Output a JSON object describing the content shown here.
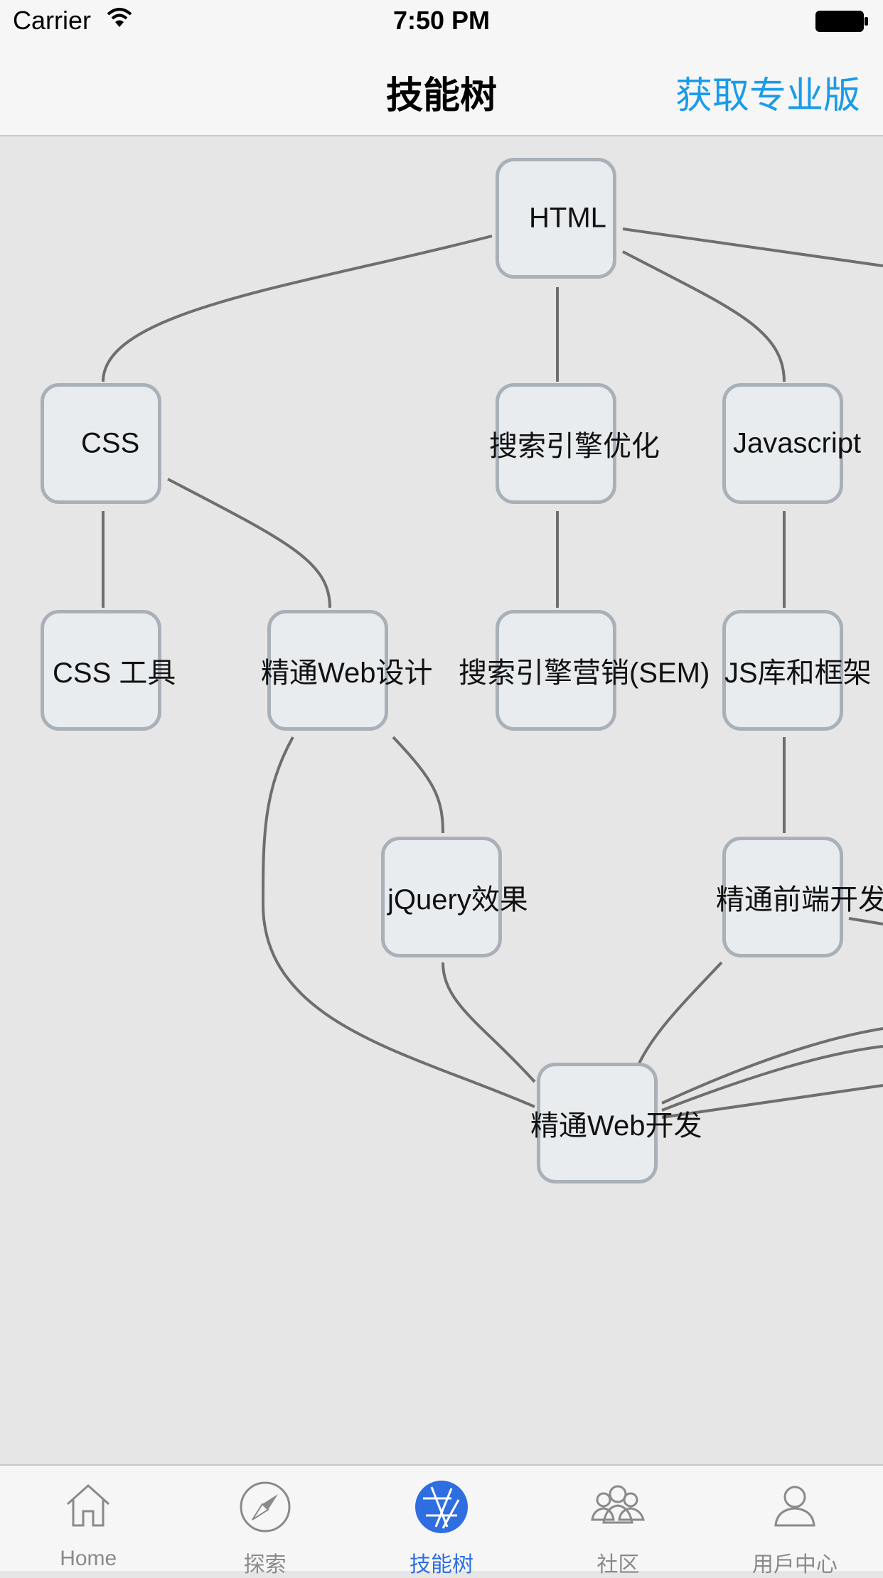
{
  "status_bar": {
    "carrier": "Carrier",
    "time": "7:50 PM"
  },
  "nav": {
    "title": "技能树",
    "pro_button": "获取专业版"
  },
  "skill_tree": {
    "nodes": [
      {
        "id": "html",
        "label": "HTML"
      },
      {
        "id": "css",
        "label": "CSS"
      },
      {
        "id": "seo",
        "label": "搜索引擎优化"
      },
      {
        "id": "javascript",
        "label": "Javascript"
      },
      {
        "id": "css-tools",
        "label": "CSS 工具"
      },
      {
        "id": "web-design",
        "label": "精通Web设计"
      },
      {
        "id": "sem",
        "label": "搜索引擎营销(SEM)"
      },
      {
        "id": "js-libs",
        "label": "JS库和框架"
      },
      {
        "id": "jquery",
        "label": "jQuery效果"
      },
      {
        "id": "frontend",
        "label": "精通前端开发"
      },
      {
        "id": "web-dev",
        "label": "精通Web开发"
      }
    ]
  },
  "tab_bar": {
    "active": "skill-tree",
    "items": [
      {
        "id": "home",
        "label": "Home",
        "icon": "home-icon"
      },
      {
        "id": "explore",
        "label": "探索",
        "icon": "compass-icon"
      },
      {
        "id": "skill-tree",
        "label": "技能树",
        "icon": "aperture-icon"
      },
      {
        "id": "community",
        "label": "社区",
        "icon": "people-icon"
      },
      {
        "id": "user-center",
        "label": "用戶中心",
        "icon": "user-icon"
      }
    ]
  },
  "colors": {
    "accent": "#1a9be8",
    "tab_active": "#2f6ee0",
    "node_border": "#a9b0b8",
    "edge": "#6e6e6e"
  }
}
